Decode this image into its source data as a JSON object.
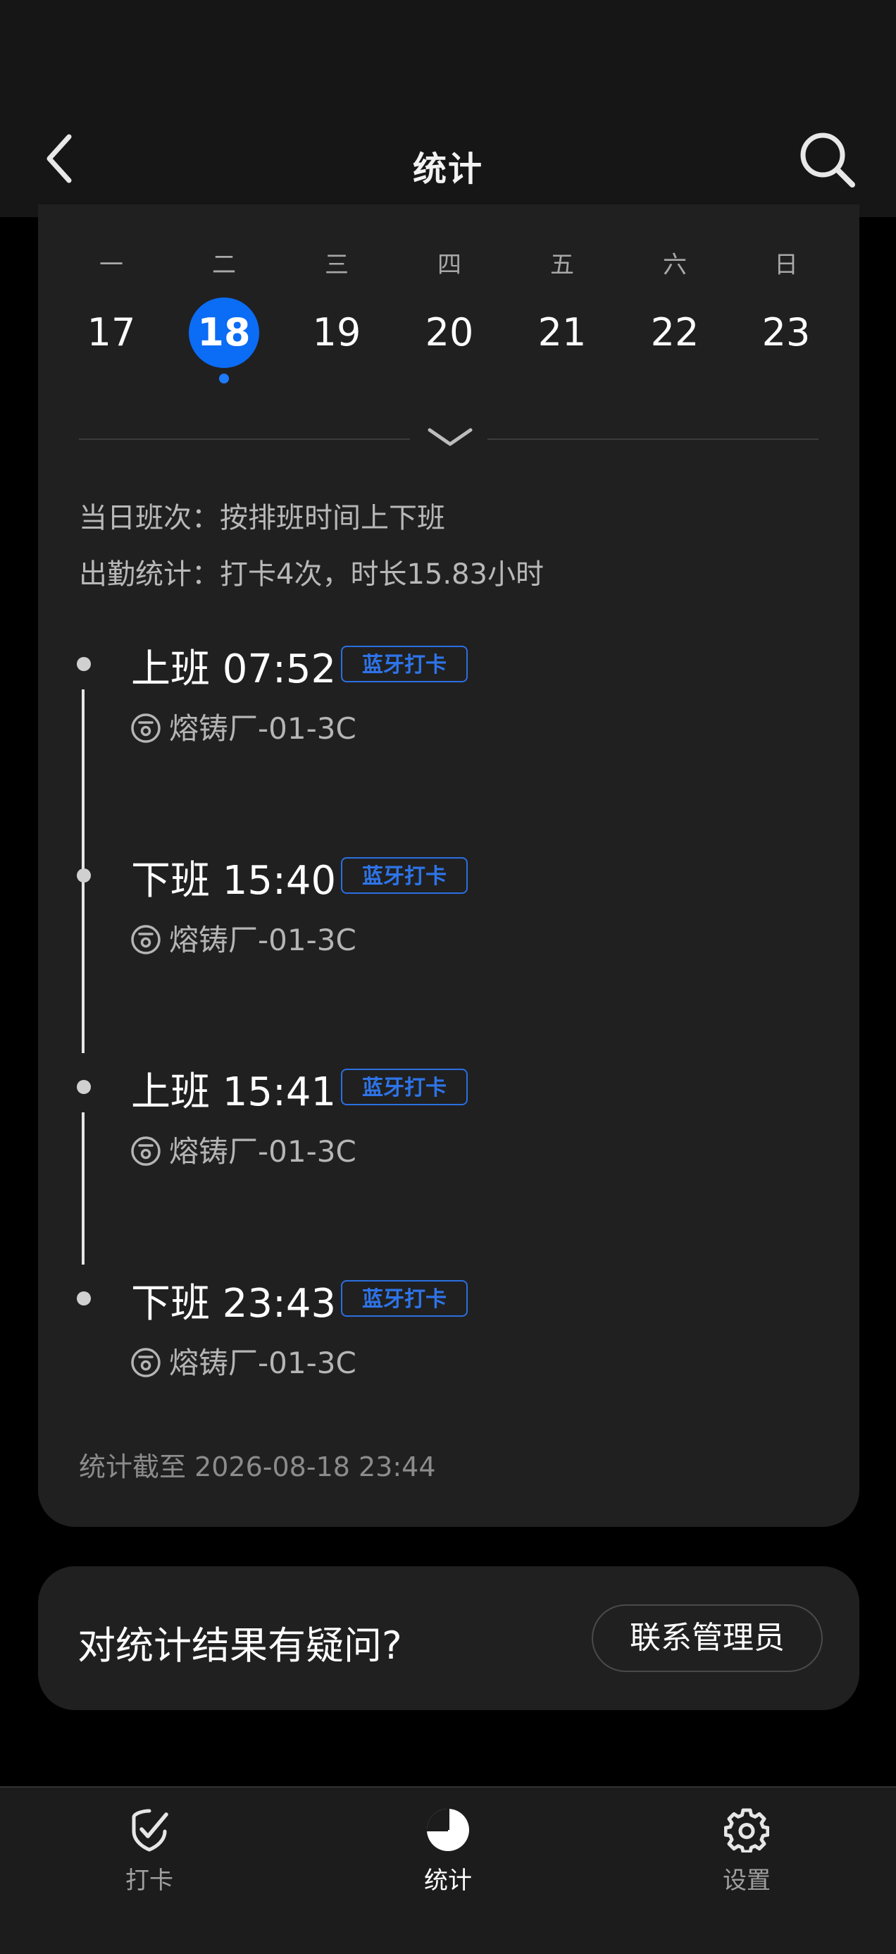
{
  "header": {
    "title": "统计"
  },
  "calendar": {
    "weekdays": [
      "一",
      "二",
      "三",
      "四",
      "五",
      "六",
      "日"
    ],
    "dates": [
      "17",
      "18",
      "19",
      "20",
      "21",
      "22",
      "23"
    ],
    "selected_index": 1
  },
  "summary": {
    "shift_line": "当日班次：按排班时间上下班",
    "attendance_line": "出勤统计：打卡4次，时长15.83小时"
  },
  "entries": [
    {
      "time_label": "上班 07:52",
      "tag": "蓝牙打卡",
      "location": "熔铸厂-01-3C"
    },
    {
      "time_label": "下班 15:40",
      "tag": "蓝牙打卡",
      "location": "熔铸厂-01-3C"
    },
    {
      "time_label": "上班 15:41",
      "tag": "蓝牙打卡",
      "location": "熔铸厂-01-3C"
    },
    {
      "time_label": "下班 23:43",
      "tag": "蓝牙打卡",
      "location": "熔铸厂-01-3C"
    }
  ],
  "footer_note": "统计截至 2026-08-18 23:44",
  "question": {
    "text": "对统计结果有疑问?",
    "button": "联系管理员"
  },
  "tabs": [
    {
      "label": "打卡",
      "icon": "check-shield-icon"
    },
    {
      "label": "统计",
      "icon": "pie-chart-icon"
    },
    {
      "label": "设置",
      "icon": "gear-icon"
    }
  ],
  "colors": {
    "accent": "#0b6cf5",
    "tag_blue": "#2e74e8",
    "background": "#000000",
    "card": "#202021"
  }
}
